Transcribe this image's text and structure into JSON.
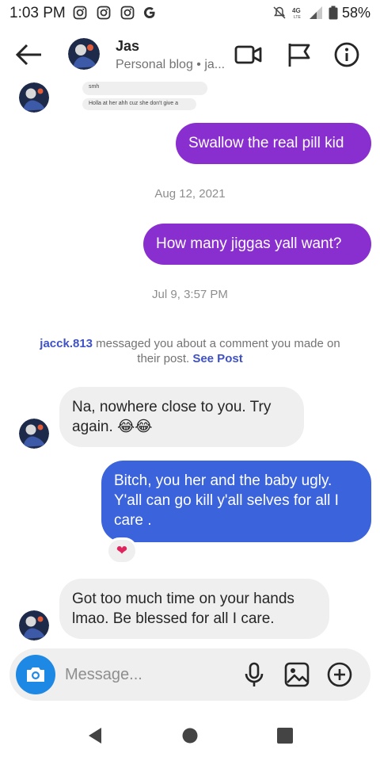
{
  "status_bar": {
    "time": "1:03 PM",
    "battery": "58%",
    "icons": [
      "instagram-icon",
      "instagram-icon",
      "instagram-icon",
      "google-icon",
      "mute-icon",
      "lte-icon",
      "signal-icon",
      "battery-icon"
    ]
  },
  "header": {
    "name": "Jas",
    "subtitle": "Personal blog • ja..."
  },
  "messages": {
    "tiny_1": "smh",
    "tiny_2": "Holla at her ahh cuz she don't give a",
    "out_1": "Swallow the real pill kid",
    "date_1": "Aug 12, 2021",
    "out_2": "How many jiggas yall want?",
    "date_2": "Jul 9, 3:57 PM",
    "notice_user": "jacck.813",
    "notice_text": " messaged you about a comment you made on their post. ",
    "notice_link": "See Post",
    "in_1": "Na, nowhere close to you. Try again. 😂😂",
    "out_3": "Bitch, you her and the baby ugly. Y'all can go kill y'all selves for all I care .",
    "reaction": "❤",
    "in_2": "Got too much time on your hands lmao. Be blessed for all I care."
  },
  "composer": {
    "placeholder": "Message..."
  },
  "colors": {
    "outgoing_purple": "#8a2fcf",
    "outgoing_blue": "#3b63dc",
    "incoming": "#efefef",
    "camera": "#1e88e5",
    "link": "#3f51c7"
  }
}
